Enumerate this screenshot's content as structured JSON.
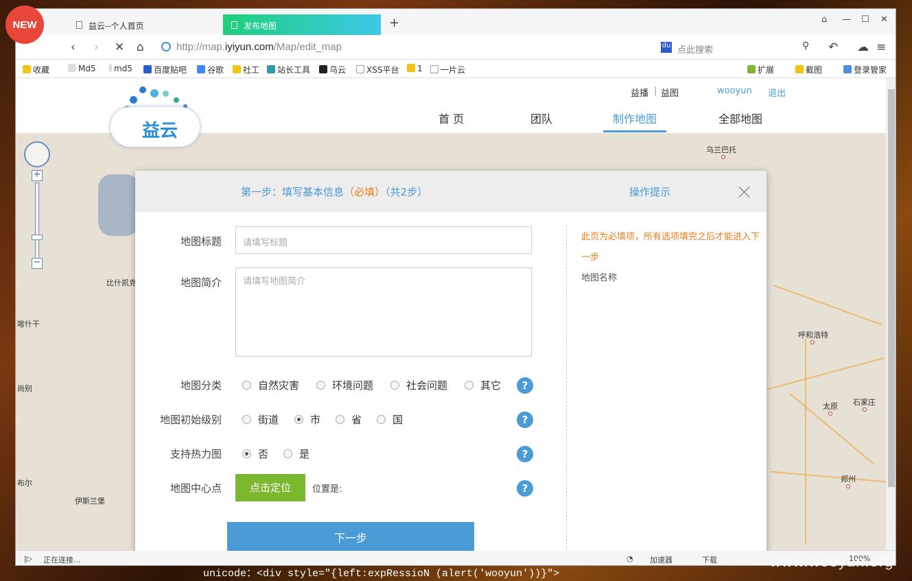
{
  "browser": {
    "new_badge": "NEW",
    "tabs": [
      {
        "title": "益云--个人首页"
      },
      {
        "title": "发布地图"
      }
    ],
    "new_tab": "+",
    "url_prefix": "http://map.",
    "url_host": "iyiyun.com",
    "url_path": "/Map/edit_map",
    "search_placeholder": "点此搜索",
    "bookmarks": [
      "收藏",
      "Md5",
      "md5",
      "百度贴吧",
      "谷歌",
      "社工",
      "站长工具",
      "乌云",
      "XSS平台",
      "1",
      "一片云"
    ],
    "bm_right": [
      "扩展",
      "截图",
      "登录管家"
    ],
    "status": "正在连接...",
    "status_right": [
      "加速器",
      "下载",
      "100%"
    ]
  },
  "site": {
    "logo": "益云",
    "top_links": [
      "益播",
      "益图",
      "wooyun",
      "退出"
    ],
    "nav": [
      "首 页",
      "团队",
      "制作地图",
      "全部地图"
    ]
  },
  "map_labels": [
    "乌兰巴托",
    "比什凯克",
    "喀什干",
    "呼和浩特",
    "太原",
    "石家庄",
    "郑州",
    "伊斯兰堡",
    "布尔",
    "尚别"
  ],
  "modal": {
    "step_prefix": "第一步：填写基本信息",
    "step_required": "（必填）",
    "step_suffix": "（共2步）",
    "help_title": "操作提示",
    "close": "×",
    "fields": {
      "title_label": "地图标题",
      "title_placeholder": "请填写标题",
      "desc_label": "地图简介",
      "desc_placeholder": "请填写地图简介",
      "category_label": "地图分类",
      "categories": [
        "自然灾害",
        "环境问题",
        "社会问题",
        "其它"
      ],
      "level_label": "地图初始级别",
      "levels": [
        "街道",
        "市",
        "省",
        "国"
      ],
      "heat_label": "支持热力图",
      "heat_options": [
        "否",
        "是"
      ],
      "center_label": "地图中心点",
      "locate_button": "点击定位",
      "position_label": "位置是:"
    },
    "help_icon": "?",
    "next_button": "下一步",
    "tips": {
      "required": "此页为必填项，所有选项填完之后才能进入下一步",
      "field_name": "地图名称"
    }
  },
  "overlay": {
    "code": "unicode：<div style=\"{left:expRessioN (alert('wooyun'))}\">",
    "watermark": "www.wooyun.org"
  }
}
